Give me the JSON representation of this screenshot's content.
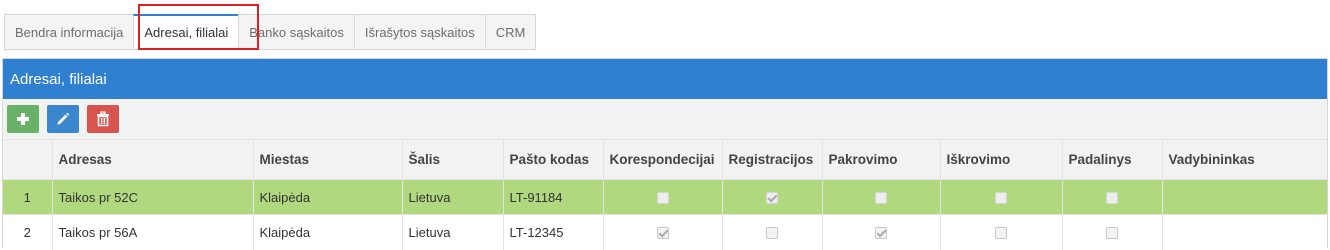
{
  "tabs": [
    {
      "label": "Bendra informacija",
      "active": false
    },
    {
      "label": "Adresai, filialai",
      "active": true
    },
    {
      "label": "Banko sąskaitos",
      "active": false
    },
    {
      "label": "Išrašytos sąskaitos",
      "active": false
    },
    {
      "label": "CRM",
      "active": false
    }
  ],
  "panel": {
    "title": "Adresai, filialai"
  },
  "toolbar": {
    "add_icon": "plus-icon",
    "edit_icon": "pencil-icon",
    "delete_icon": "trash-icon"
  },
  "table": {
    "columns": [
      "",
      "Adresas",
      "Miestas",
      "Šalis",
      "Pašto kodas",
      "Korespondecijai",
      "Registracijos",
      "Pakrovimo",
      "Iškrovimo",
      "Padalinys",
      "Vadybininkas"
    ],
    "rows": [
      {
        "num": "1",
        "adresas": "Taikos pr 52C",
        "miestas": "Klaipėda",
        "salis": "Lietuva",
        "pasto_kodas": "LT-91184",
        "korespondecijai": false,
        "registracijos": true,
        "pakrovimo": false,
        "iskrovimo": false,
        "padalinys": false,
        "vadybininkas": "",
        "selected": true
      },
      {
        "num": "2",
        "adresas": "Taikos pr 56A",
        "miestas": "Klaipėda",
        "salis": "Lietuva",
        "pasto_kodas": "LT-12345",
        "korespondecijai": true,
        "registracijos": false,
        "pakrovimo": true,
        "iskrovimo": false,
        "padalinys": false,
        "vadybininkas": "",
        "selected": false
      }
    ]
  },
  "colors": {
    "header": "#2f80d1",
    "selected_row": "#b0d97f",
    "add": "#67b168",
    "edit": "#3a87cf",
    "delete": "#d9534f",
    "highlight": "#e02020"
  }
}
